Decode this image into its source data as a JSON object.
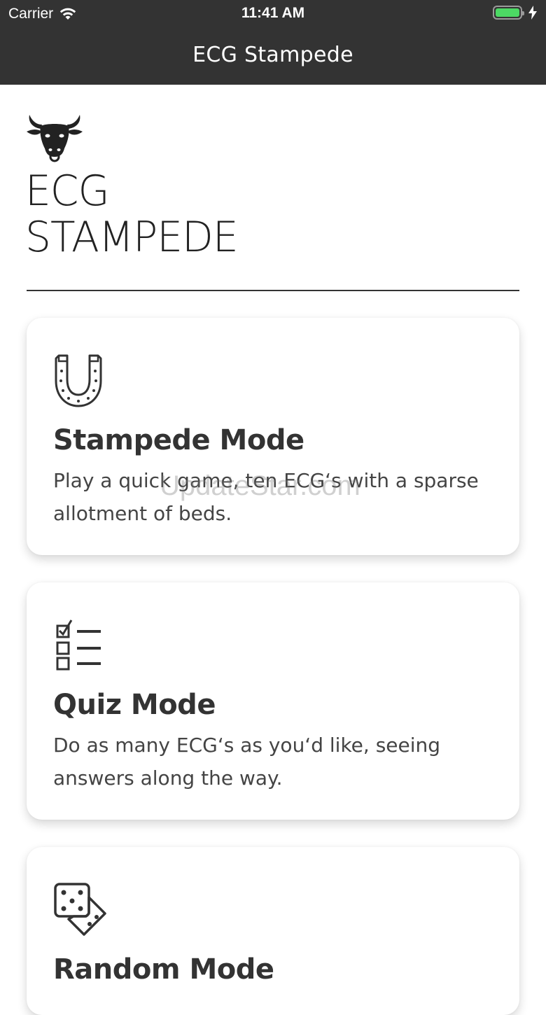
{
  "status_bar": {
    "carrier": "Carrier",
    "time": "11:41 AM",
    "battery_color": "#4cd964"
  },
  "nav": {
    "title": "ECG Stampede"
  },
  "header": {
    "logo_icon": "bull-head-icon",
    "title_line1": "ECG",
    "title_line2": "STAMPEDE"
  },
  "cards": [
    {
      "icon": "horseshoe-icon",
      "title": "Stampede Mode",
      "description": "Play a quick game, ten ECG‘s with a sparse allotment of beds."
    },
    {
      "icon": "checklist-icon",
      "title": "Quiz Mode",
      "description": "Do as many ECG‘s as you‘d like, seeing answers along the way."
    },
    {
      "icon": "dice-icon",
      "title": "Random Mode",
      "description": ""
    }
  ],
  "watermark": "UpdateStar.com",
  "colors": {
    "bar_background": "#333333",
    "text_dark": "#333333",
    "card_background": "#ffffff"
  }
}
